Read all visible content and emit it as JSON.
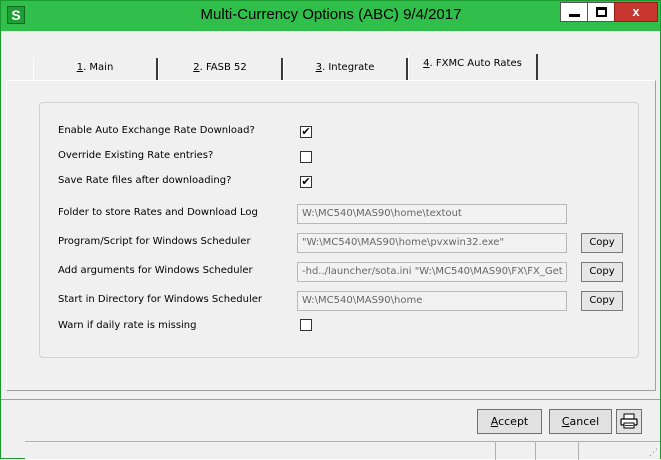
{
  "window": {
    "app_icon_letter": "S",
    "title": "Multi-Currency Options  (ABC) 9/4/2017",
    "close_glyph": "x"
  },
  "tabs": [
    {
      "key": "1",
      "rest": ". Main"
    },
    {
      "key": "2",
      "rest": ". FASB 52"
    },
    {
      "key": "3",
      "rest": ". Integrate"
    },
    {
      "key": "4",
      "rest": ". FXMC Auto Rates"
    }
  ],
  "active_tab": "4. FXMC Auto Rates",
  "form": {
    "enable_auto": {
      "label": "Enable Auto Exchange Rate Download?",
      "checked": true
    },
    "override": {
      "label": "Override Existing Rate entries?",
      "checked": false
    },
    "save_files": {
      "label": "Save Rate files after downloading?",
      "checked": true
    },
    "folder": {
      "label": "Folder to store Rates and Download Log",
      "value": "W:\\MC540\\MAS90\\home\\textout"
    },
    "program": {
      "label": "Program/Script for Windows Scheduler",
      "value": "\"W:\\MC540\\MAS90\\home\\pvxwin32.exe\""
    },
    "arguments": {
      "label": "Add arguments for Windows Scheduler",
      "value": "-hd../launcher/sota.ini \"W:\\MC540\\MAS90\\FX\\FX_Get"
    },
    "start_dir": {
      "label": "Start in Directory for Windows Scheduler",
      "value": "W:\\MC540\\MAS90\\home"
    },
    "warn_missing": {
      "label": "Warn if daily rate is missing",
      "checked": false
    },
    "copy_label": "Copy"
  },
  "buttons": {
    "accept": {
      "key": "A",
      "rest": "ccept"
    },
    "cancel": {
      "key": "C",
      "rest": "ancel"
    }
  },
  "icons": {
    "app": "sage-s-icon",
    "print": "printer-icon"
  }
}
